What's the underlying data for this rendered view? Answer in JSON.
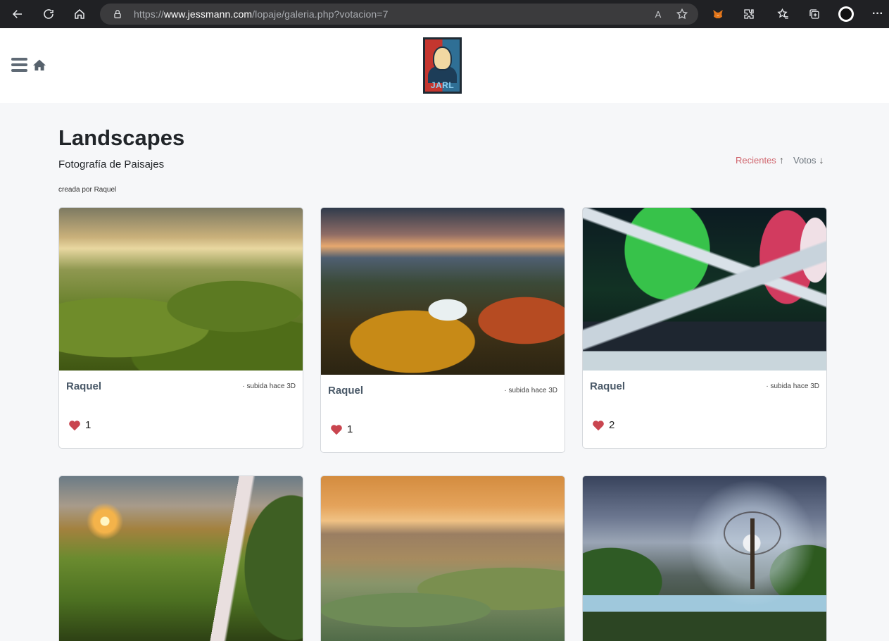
{
  "browser": {
    "url_prefix": "https://",
    "url_domain": "www.jessmann.com",
    "url_path": "/lopaje/galeria.php?votacion=7",
    "icons": [
      "back-arrow-icon",
      "reload-icon",
      "home-icon",
      "lock-icon",
      "read-aloud-icon",
      "add-favorite-icon",
      "metamask-fox-icon",
      "extensions-icon",
      "favorites-icon",
      "collections-icon",
      "profile-avatar-icon",
      "more-menu-icon"
    ],
    "read_aloud_glyph": "A",
    "more_glyph": "···"
  },
  "header": {
    "logo_text": "JARL"
  },
  "gallery": {
    "title": "Landscapes",
    "subtitle": "Fotografía de Paisajes",
    "creator_line": "creada por Raquel",
    "sort": {
      "recent_label": "Recientes",
      "recent_arrow": "↑",
      "votes_label": "Votos",
      "votes_arrow": "↓",
      "active": "recent"
    },
    "cards": [
      {
        "author": "Raquel",
        "uploaded": "· subida hace 3D",
        "likes": "1",
        "image": "rolling-green-hills"
      },
      {
        "author": "Raquel",
        "uploaded": "· subida hace 3D",
        "likes": "1",
        "image": "mountain-flowers-sunset"
      },
      {
        "author": "Raquel",
        "uploaded": "· subida hace 3D",
        "likes": "2",
        "image": "aurora-borealis"
      },
      {
        "image": "waterfall-sunset"
      },
      {
        "image": "tuscany-town"
      },
      {
        "image": "tree-in-light"
      }
    ]
  },
  "colors": {
    "accent_sort": "#d0656d",
    "heart": "#c9454f",
    "author": "#4a5968",
    "page_bg": "#f6f7f9"
  }
}
